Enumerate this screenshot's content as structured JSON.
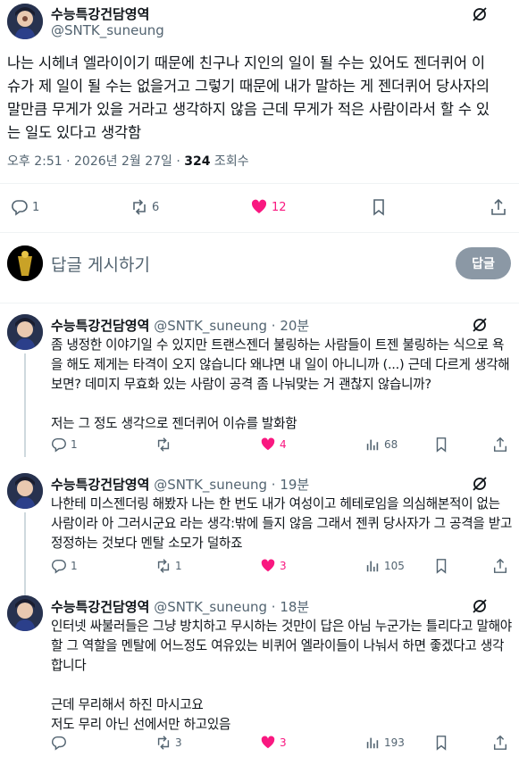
{
  "main_post": {
    "author_name": "수능특강건담영역",
    "author_handle": "@SNTK_suneung",
    "text_lines": [
      "나는 시헤녀 엘라이이기 때문에 친구나 지인의 일이 될 수는 있어도 젠더퀴어 이",
      "슈가 제 일이 될 수는 없을거고 그렇기 때문에 내가 말하는 게 젠더퀴어 당사자의",
      "말만큼 무게가 있을 거라고 생각하지 않음 근데 무게가 적은 사람이라서 할 수 있",
      "는 일도 있다고 생각함"
    ],
    "time": "오후 2:51 · 2026년 2월 27일 · ",
    "views_count": "324",
    "views_label": " 조회수",
    "reply_count": "1",
    "retweet_count": "6",
    "like_count": "12"
  },
  "composer": {
    "placeholder": "답글 게시하기",
    "button_label": "답글"
  },
  "replies": [
    {
      "author_name": "수능특강건담영역",
      "handle_time": "@SNTK_suneung · 20분",
      "paragraphs": [
        "좀 냉정한 이야기일 수 있지만 트랜스젠더 불링하는 사람들이 트젠 불링하는 식으로 욕을 해도 제게는 타격이 오지 않습니다 왜냐면 내 일이 아니니까 (...) 근데 다르게 생각해보면? 데미지 무효화 있는 사람이 공격 좀 나눠맞는 거 괜찮지 않습니까?",
        "",
        "저는 그 정도 생각으로 젠더퀴어 이슈를 발화함"
      ],
      "reply_count": "1",
      "retweet_count": "",
      "like_count": "4",
      "views_count": "68"
    },
    {
      "author_name": "수능특강건담영역",
      "handle_time": "@SNTK_suneung · 19분",
      "paragraphs": [
        "나한테 미스젠더링 해봤자 나는 한 번도 내가 여성이고 헤테로임을 의심해본적이 없는 사람이라 아 그러시군요 라는 생각:밖에 들지 않음 그래서 젠퀴 당사자가 그 공격을 받고 정정하는 것보다 멘탈 소모가 덜하죠"
      ],
      "reply_count": "1",
      "retweet_count": "1",
      "like_count": "3",
      "views_count": "105"
    },
    {
      "author_name": "수능특강건담영역",
      "handle_time": "@SNTK_suneung · 18분",
      "paragraphs": [
        "인터넷 싸불러들은 그냥 방치하고 무시하는 것만이 답은 아님 누군가는 틀리다고 말해야 할 그 역할을 멘탈에 어느정도 여유있는 비퀴어 엘라이들이 나눠서 하면 좋겠다고 생각합니다",
        "",
        "근데 무리해서 하진 마시고요",
        "저도 무리 아닌 선에서만 하고있음"
      ],
      "reply_count": "",
      "retweet_count": "3",
      "like_count": "3",
      "views_count": "193"
    }
  ],
  "colors": {
    "like": "#f91880",
    "muted": "#536471",
    "button": "#8b98a5"
  },
  "icons": [
    "grok-icon",
    "reply-icon",
    "retweet-icon",
    "heart-icon",
    "bookmark-icon",
    "share-icon",
    "views-icon"
  ]
}
